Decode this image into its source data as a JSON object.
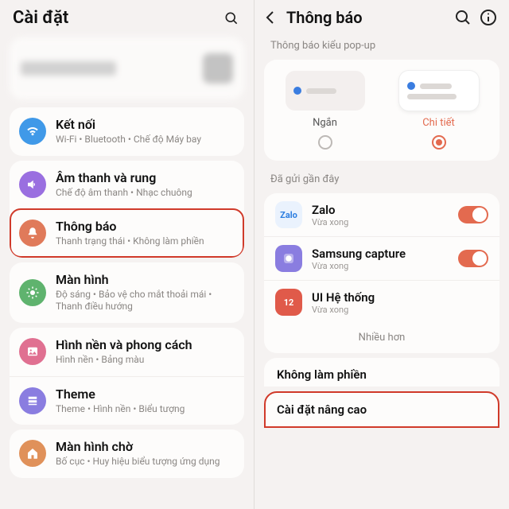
{
  "left": {
    "title": "Cài đặt",
    "items": [
      {
        "icon": "wifi-icon",
        "color": "#4099e8",
        "title": "Kết nối",
        "sub": "Wi-Fi • Bluetooth • Chế độ Máy bay"
      },
      {
        "icon": "sound-icon",
        "color": "#9a6fe0",
        "title": "Âm thanh và rung",
        "sub": "Chế độ âm thanh • Nhạc chuông"
      },
      {
        "icon": "bell-icon",
        "color": "#e07a5a",
        "title": "Thông báo",
        "sub": "Thanh trạng thái • Không làm phiền",
        "highlight": true
      },
      {
        "icon": "display-icon",
        "color": "#5fb36e",
        "title": "Màn hình",
        "sub": "Độ sáng • Bảo vệ cho mắt thoải mái • Thanh điều hướng"
      },
      {
        "icon": "image-icon",
        "color": "#e07091",
        "title": "Hình nền và phong cách",
        "sub": "Hình nền • Bảng màu"
      },
      {
        "icon": "palette-icon",
        "color": "#8a7de0",
        "title": "Theme",
        "sub": "Theme • Hình nền • Biểu tượng"
      },
      {
        "icon": "home-icon",
        "color": "#e0915a",
        "title": "Màn hình chờ",
        "sub": "Bố cục • Huy hiệu biểu tượng ứng dụng"
      }
    ]
  },
  "right": {
    "title": "Thông báo",
    "popup_label": "Thông báo kiểu pop-up",
    "popup_options": [
      {
        "id": "short",
        "label": "Ngắn",
        "selected": false
      },
      {
        "id": "detail",
        "label": "Chi tiết",
        "selected": true
      }
    ],
    "recent_label": "Đã gửi gần đây",
    "recent": [
      {
        "name": "Zalo",
        "sub": "Vừa xong",
        "icon_text": "Zalo",
        "bg": "#eaf2fd",
        "fg": "#2b7de0",
        "toggle": true
      },
      {
        "name": "Samsung capture",
        "sub": "Vừa xong",
        "icon_text": "",
        "bg": "#8a7de0",
        "fg": "#fff",
        "toggle": true
      },
      {
        "name": "UI Hệ thống",
        "sub": "Vừa xong",
        "icon_text": "12",
        "bg": "#e05a4a",
        "fg": "#fff",
        "toggle": false
      }
    ],
    "more_label": "Nhiều hơn",
    "dnd_label": "Không làm phiền",
    "advanced_label": "Cài đặt nâng cao"
  }
}
